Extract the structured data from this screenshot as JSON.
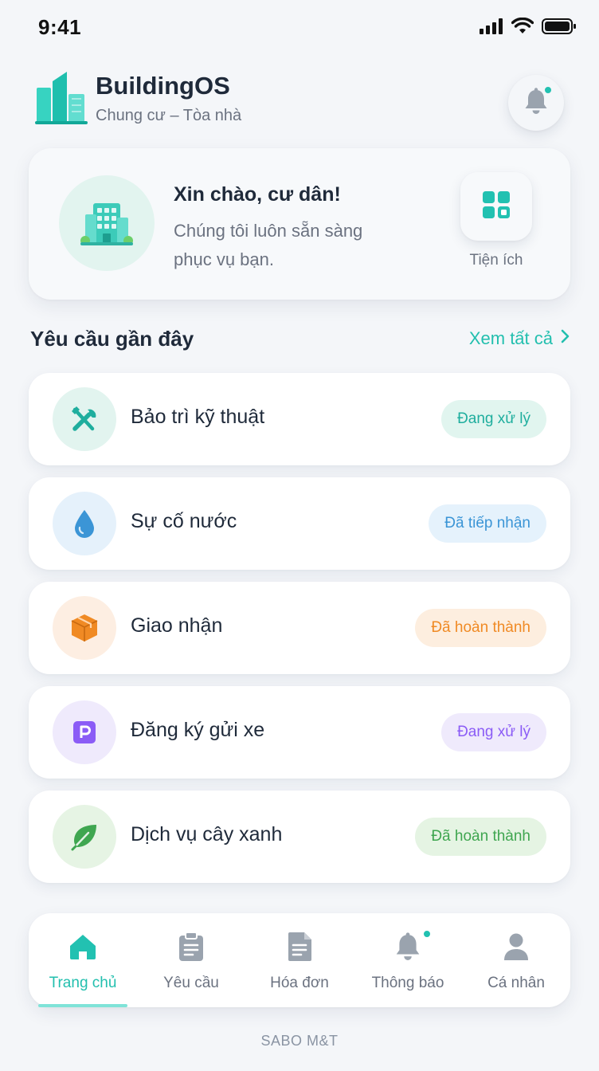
{
  "status_bar": {
    "time": "9:41"
  },
  "header": {
    "app_name": "BuildingOS",
    "subtitle": "Chung cư – Tòa nhà"
  },
  "welcome": {
    "title": "Xin chào, cư dân!",
    "message": "Chúng tôi luôn sẵn sàng phục vụ bạn.",
    "utility_label": "Tiện ích"
  },
  "requests": {
    "section_title": "Yêu cầu gần đây",
    "see_all": "Xem tất cả",
    "items": [
      {
        "title": "Bảo trì kỹ thuật",
        "status": "Đang xử lý",
        "icon": "wrench-icon"
      },
      {
        "title": "Sự cố nước",
        "status": "Đã tiếp nhận",
        "icon": "water-drop-icon"
      },
      {
        "title": "Giao nhận",
        "status": "Đã hoàn thành",
        "icon": "package-icon"
      },
      {
        "title": "Đăng ký gửi xe",
        "status": "Đang xử lý",
        "icon": "parking-icon"
      },
      {
        "title": "Dịch vụ cây xanh",
        "status": "Đã hoàn thành",
        "icon": "leaf-icon"
      }
    ]
  },
  "nav": {
    "items": [
      {
        "label": "Trang chủ",
        "icon": "home-icon",
        "active": true
      },
      {
        "label": "Yêu cầu",
        "icon": "clipboard-icon",
        "active": false
      },
      {
        "label": "Hóa đơn",
        "icon": "invoice-icon",
        "active": false
      },
      {
        "label": "Thông báo",
        "icon": "bell-icon",
        "active": false
      },
      {
        "label": "Cá nhân",
        "icon": "person-icon",
        "active": false
      }
    ]
  },
  "footer": {
    "text": "SABO M&T"
  },
  "colors": {
    "accent": "#22bfae",
    "status_processing_teal": "#1fae9e",
    "status_received_blue": "#3b95d6",
    "status_done_orange": "#f08a24",
    "status_processing_purple": "#8b5cf6",
    "status_done_green": "#3fa650"
  }
}
